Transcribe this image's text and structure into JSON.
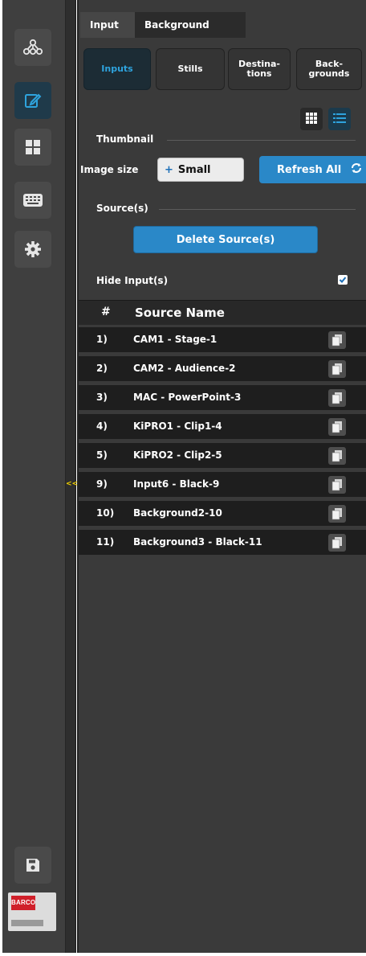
{
  "sidebar": {
    "icons": [
      "network-icon",
      "edit-icon",
      "layout-grid-icon",
      "keyboard-icon",
      "gear-icon",
      "save-icon"
    ],
    "active": "edit-icon",
    "logo_text": "BARCO"
  },
  "collapse": {
    "label": "<<"
  },
  "tabs": {
    "top": [
      "Input",
      "Background"
    ],
    "sub": [
      "Inputs",
      "Stills",
      "Destina-\ntions",
      "Back-\ngrounds"
    ],
    "active_sub": "Inputs"
  },
  "thumbnail": {
    "section_label": "Thumbnail",
    "image_size_label": "Image size",
    "size_prefix": "+",
    "size_value": "Small",
    "refresh_label": "Refresh All"
  },
  "sources": {
    "section_label": "Source(s)",
    "delete_label": "Delete Source(s)",
    "hide_label": "Hide Input(s)",
    "hide_checked": true
  },
  "table": {
    "columns": [
      "#",
      "Source Name"
    ],
    "rows": [
      {
        "num": "1)",
        "name": "CAM1 - Stage-1"
      },
      {
        "num": "2)",
        "name": "CAM2 - Audience-2"
      },
      {
        "num": "3)",
        "name": "MAC - PowerPoint-3"
      },
      {
        "num": "4)",
        "name": "KiPRO1 - Clip1-4"
      },
      {
        "num": "5)",
        "name": "KiPRO2 - Clip2-5"
      },
      {
        "num": "9)",
        "name": "Input6 - Black-9"
      },
      {
        "num": "10)",
        "name": "Background2-10"
      },
      {
        "num": "11)",
        "name": "Background3 - Black-11"
      }
    ]
  },
  "colors": {
    "accent": "#2a88c8",
    "active_tab_text": "#2ea3dd",
    "panel_bg": "#3a3a3a",
    "row_bg": "#1e1e1e",
    "collapse_arrow": "#f0d000",
    "logo_red": "#d0202a"
  }
}
